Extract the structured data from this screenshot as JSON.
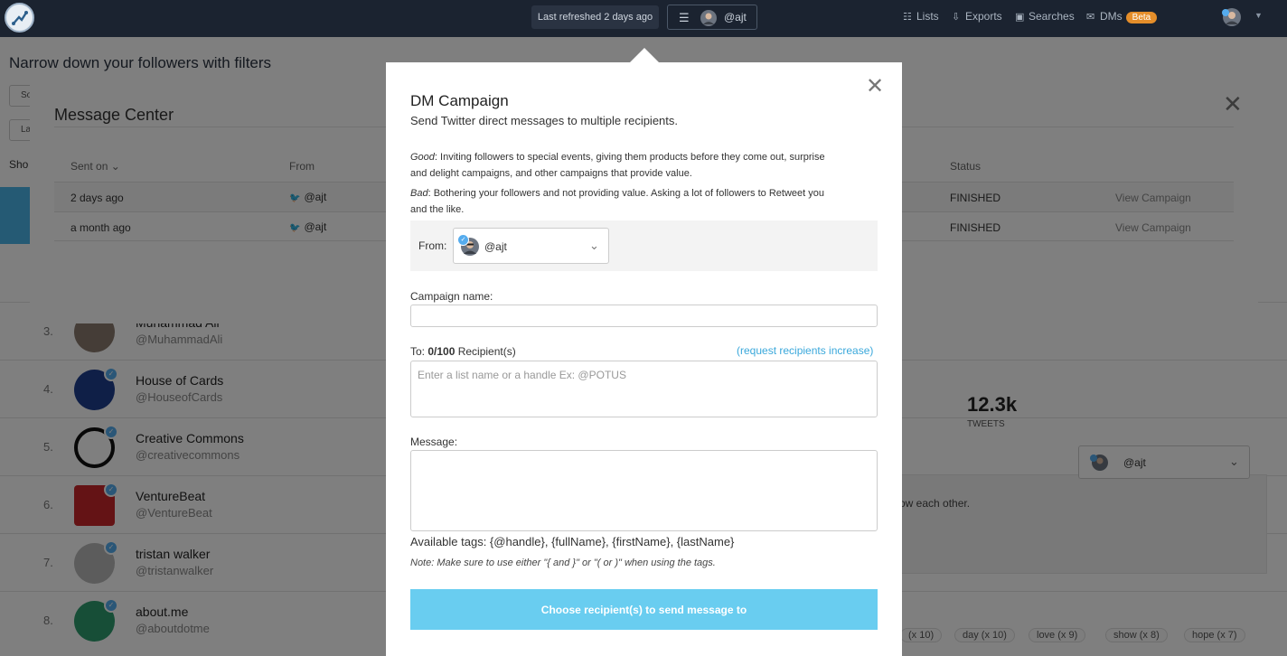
{
  "topbar": {
    "refresh_text": "Last refreshed 2 days ago",
    "account_handle": "@ajt",
    "nav": [
      {
        "label": "Lists",
        "icon": "list-icon"
      },
      {
        "label": "Exports",
        "icon": "download-icon"
      },
      {
        "label": "Searches",
        "icon": "save-icon"
      },
      {
        "label": "DMs",
        "icon": "chat-icon",
        "badge": "Beta"
      }
    ]
  },
  "background": {
    "filters_title": "Narrow down your followers with filters",
    "button_1": "So",
    "button_2": "La",
    "show_text": "Sho",
    "rows": [
      {
        "num": "3.",
        "name": "Muhammad Ali",
        "handle": "@MuhammadAli"
      },
      {
        "num": "4.",
        "name": "House of Cards",
        "handle": "@HouseofCards"
      },
      {
        "num": "5.",
        "name": "Creative Commons",
        "handle": "@creativecommons"
      },
      {
        "num": "6.",
        "name": "VentureBeat",
        "handle": "@VentureBeat"
      },
      {
        "num": "7.",
        "name": "tristan walker",
        "handle": "@tristanwalker"
      },
      {
        "num": "8.",
        "name": "about.me",
        "handle": "@aboutdotme"
      }
    ],
    "tweets_value": "12.3k",
    "tweets_label": "TWEETS",
    "panel_text": "ow each other.",
    "select_handle": "@ajt",
    "tags": [
      "(x 10)",
      "day (x 10)",
      "love (x 9)",
      "show (x 8)",
      "hope (x 7)"
    ]
  },
  "message_center": {
    "title": "Message Center",
    "columns": [
      "Sent on",
      "From",
      "Status"
    ],
    "rows": [
      {
        "sent_on": "2 days ago",
        "from": "@ajt",
        "status": "FINISHED",
        "action": "View Campaign"
      },
      {
        "sent_on": "a month ago",
        "from": "@ajt",
        "status": "FINISHED",
        "action": "View Campaign"
      }
    ]
  },
  "dm_campaign": {
    "title": "DM Campaign",
    "subtitle": "Send Twitter direct messages to multiple recipients.",
    "good_label": "Good",
    "good_text": ": Inviting followers to special events, giving them products before they come out, surprise and delight campaigns, and other campaigns that provide value.",
    "bad_label": "Bad",
    "bad_text": ": Bothering your followers and not providing value. Asking a lot of followers to Retweet you and the like.",
    "from_label": "From:",
    "from_handle": "@ajt",
    "campaign_name_label": "Campaign name:",
    "campaign_name_value": "",
    "to_prefix": "To: ",
    "to_count": "0/100",
    "to_suffix": " Recipient(s)",
    "request_link": "(request recipients increase)",
    "recipients_placeholder": "Enter a list name or a handle Ex: @POTUS",
    "message_label": "Message:",
    "message_value": "",
    "tags_text": "Available tags: {@handle}, {fullName}, {firstName}, {lastName}",
    "note_text": "Note: Make sure to use either \"{ and }\" or \"( or )\" when using the tags.",
    "submit_label": "Choose recipient(s) to send message to"
  },
  "colors": {
    "nav_bg": "#1b2330",
    "accent": "#3aa8db",
    "submit_bg": "#69cdf0",
    "beta_badge": "#e58e2a",
    "twitter_blue": "#55acee"
  }
}
